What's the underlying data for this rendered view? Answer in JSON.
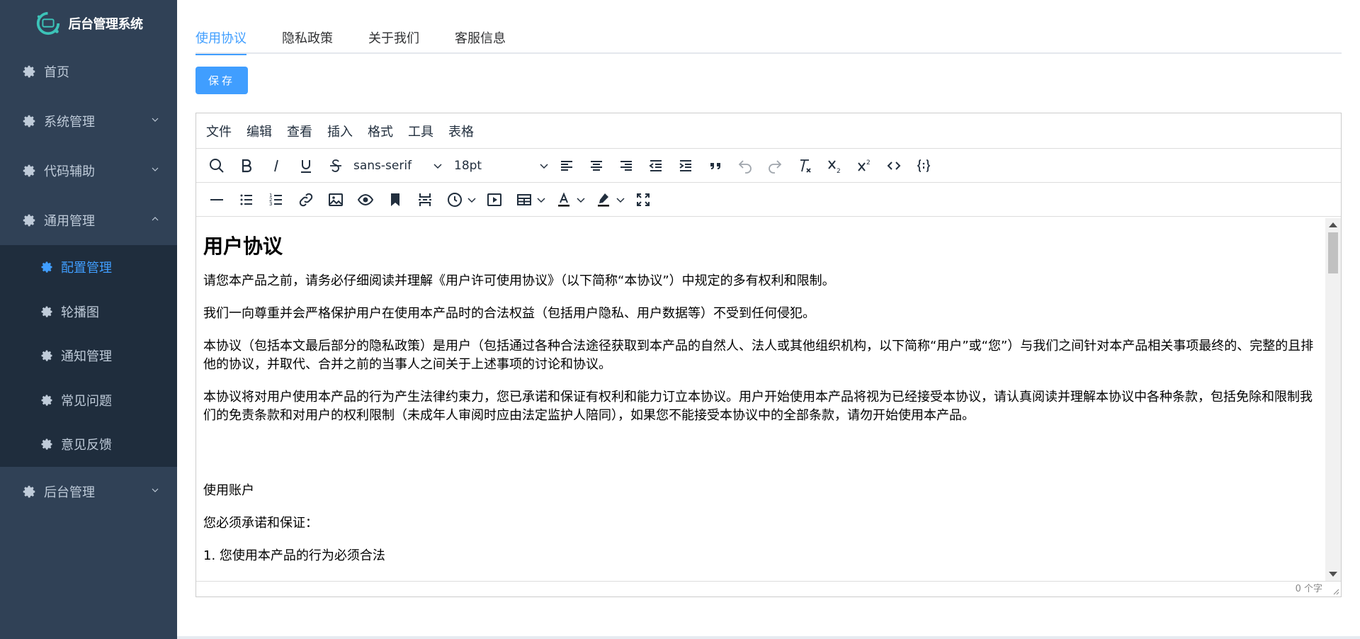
{
  "app": {
    "title": "后台管理系统"
  },
  "sidebar": {
    "items": [
      {
        "label": "首页",
        "expandable": false
      },
      {
        "label": "系统管理",
        "expandable": true
      },
      {
        "label": "代码辅助",
        "expandable": true
      },
      {
        "label": "通用管理",
        "expandable": true,
        "expanded": true
      },
      {
        "label": "后台管理",
        "expandable": true
      }
    ],
    "sub_items": [
      {
        "label": "配置管理",
        "active": true
      },
      {
        "label": "轮播图"
      },
      {
        "label": "通知管理"
      },
      {
        "label": "常见问题"
      },
      {
        "label": "意见反馈"
      }
    ]
  },
  "tabs": [
    "使用协议",
    "隐私政策",
    "关于我们",
    "客服信息"
  ],
  "save_label": "保存",
  "editor": {
    "menus": [
      "文件",
      "编辑",
      "查看",
      "插入",
      "格式",
      "工具",
      "表格"
    ],
    "font_family": "sans-serif",
    "font_size": "18pt",
    "word_count": "0 个字"
  },
  "content": {
    "heading": "用户协议",
    "paragraphs": [
      "请您本产品之前，请务必仔细阅读并理解《用户许可使用协议》（以下简称“本协议”）中规定的多有权利和限制。",
      "我们一向尊重并会严格保护用户在使用本产品时的合法权益（包括用户隐私、用户数据等）不受到任何侵犯。",
      "本协议（包括本文最后部分的隐私政策）是用户（包括通过各种合法途径获取到本产品的自然人、法人或其他组织机构，以下简称“用户”或“您”）与我们之间针对本产品相关事项最终的、完整的且排他的协议，并取代、合并之前的当事人之间关于上述事项的讨论和协议。",
      "本协议将对用户使用本产品的行为产生法律约束力，您已承诺和保证有权利和能力订立本协议。用户开始使用本产品将视为已经接受本协议，请认真阅读并理解本协议中各种条款，包括免除和限制我们的免责条款和对用户的权利限制（未成年人审阅时应由法定监护人陪同），如果您不能接受本协议中的全部条款，请勿开始使用本产品。",
      "",
      "使用账户",
      "您必须承诺和保证：",
      "1. 您使用本产品的行为必须合法"
    ]
  },
  "colors": {
    "sidebar_bg": "#304156",
    "submenu_bg": "#1f2d3d",
    "accent": "#409eff",
    "sidebar_text": "#bfcbd9"
  }
}
